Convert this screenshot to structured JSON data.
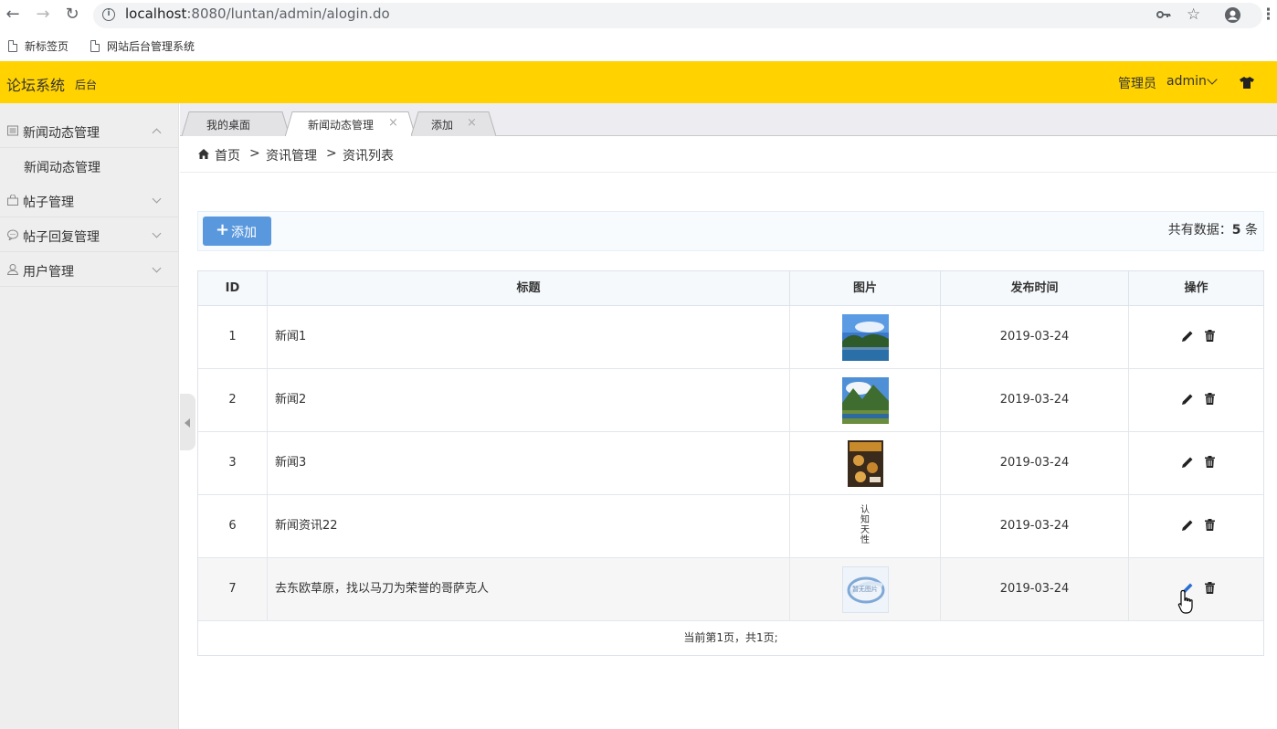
{
  "browser": {
    "url_host": "localhost",
    "url_rest": ":8080/luntan/admin/alogin.do",
    "bookmarks": [
      "新标签页",
      "网站后台管理系统"
    ]
  },
  "header": {
    "logo": "论坛系统",
    "logo_sub": "后台",
    "role": "管理员",
    "user": "admin",
    "bg_color": "#ffd200"
  },
  "sidebar": {
    "items": [
      {
        "label": "新闻动态管理",
        "icon": "newspaper-icon",
        "expanded": true
      },
      {
        "label": "帖子管理",
        "icon": "bag-icon",
        "expanded": false
      },
      {
        "label": "帖子回复管理",
        "icon": "chat-bubble-icon",
        "expanded": false
      },
      {
        "label": "用户管理",
        "icon": "user-icon",
        "expanded": false
      }
    ],
    "subitem": "新闻动态管理"
  },
  "tabs": [
    {
      "label": "我的桌面",
      "closable": false
    },
    {
      "label": "新闻动态管理",
      "closable": true,
      "active": true
    },
    {
      "label": "添加",
      "closable": true
    }
  ],
  "tab_close_glyph": "×",
  "breadcrumb": {
    "home": "首页",
    "sep": ">",
    "level1": "资讯管理",
    "level2": "资讯列表"
  },
  "toolbar": {
    "add_label": "添加",
    "total_prefix": "共有数据：",
    "total_count": "5",
    "total_suffix": " 条"
  },
  "table": {
    "headers": [
      "ID",
      "标题",
      "图片",
      "发布时间",
      "操作"
    ],
    "rows": [
      {
        "id": "1",
        "title": "新闻1",
        "image": "lake-landscape-thumb",
        "date": "2019-03-24"
      },
      {
        "id": "2",
        "title": "新闻2",
        "image": "mountain-river-thumb",
        "date": "2019-03-24"
      },
      {
        "id": "3",
        "title": "新闻3",
        "image": "book-cover-thumb",
        "date": "2019-03-24"
      },
      {
        "id": "6",
        "title": "新闻资讯22",
        "image": "calligraphy-thumb",
        "date": "2019-03-24"
      },
      {
        "id": "7",
        "title": "去东欧草原，找以马刀为荣誉的哥萨克人",
        "image": "placeholder-logo-thumb",
        "date": "2019-03-24"
      }
    ],
    "pager": "当前第1页，共1页;"
  },
  "thumb_calligraphy": "认知天性",
  "thumb_logo": "暂无图片"
}
